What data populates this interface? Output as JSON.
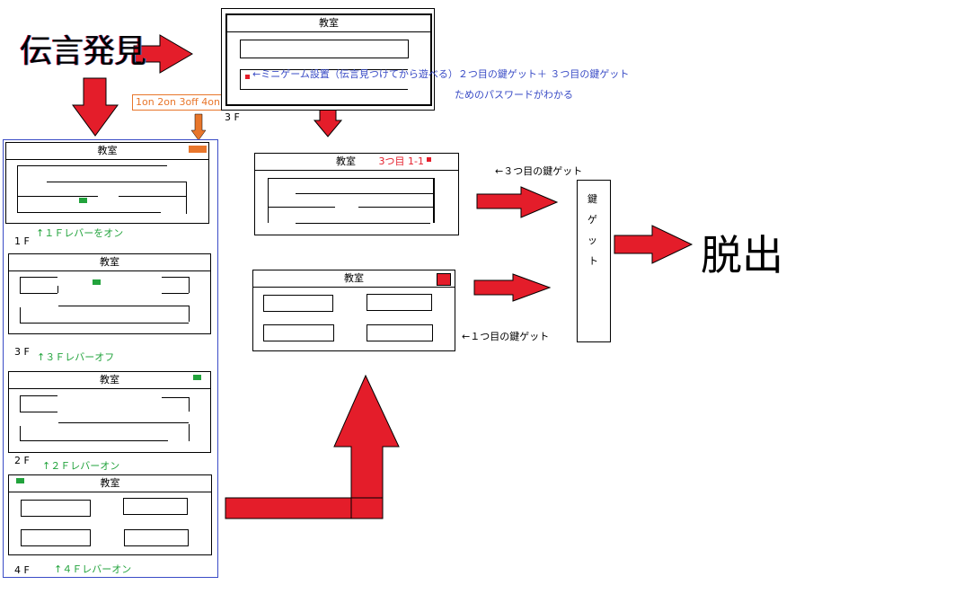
{
  "title": "伝言発見",
  "escape": "脱出",
  "lever_code": "1on 2on 3off 4on",
  "room_label": "教室",
  "top_room": {
    "floor": "3 F",
    "note_line1": "←ミニゲーム設置（伝言見つけてから遊べる）２つ目の鍵ゲット＋ ３つ目の鍵ゲット",
    "note_line2": "ためのパスワードがわかる"
  },
  "mid_room1": {
    "tag": "3つ目 1-1",
    "note": "←３つ目の鍵ゲット"
  },
  "mid_room2": {
    "note": "←１つ目の鍵ゲット"
  },
  "key_box": {
    "chars": [
      "鍵",
      "ゲ",
      "ッ",
      "ト"
    ]
  },
  "floors": [
    {
      "floor": "1 F",
      "lever_note": "↑１Ｆレバーをオン"
    },
    {
      "floor": "3 F",
      "lever_note": "↑３Ｆレバーオフ"
    },
    {
      "floor": "2 F",
      "lever_note": "↑２Ｆレバーオン"
    },
    {
      "floor": "4 F",
      "lever_note": "↑４Ｆレバーオン"
    }
  ],
  "colors": {
    "arrow_red": "#e41d2a",
    "lever_green": "#22a33c",
    "note_blue": "#3a4cc6",
    "code_orange": "#e8762b"
  }
}
